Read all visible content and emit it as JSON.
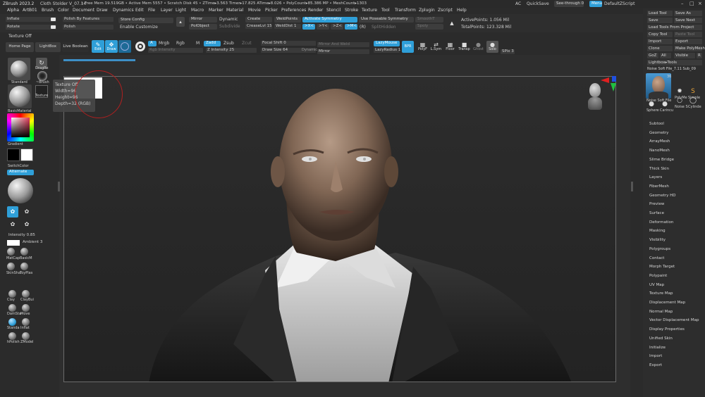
{
  "app": {
    "title": "ZBrush 2023.2",
    "project": "Cloth Stolder V_07.14",
    "stats": "• Free Mem 19.519GB • Active Mem 5557 • Scratch Disk 45 • ZTime▸3.563 Timer▸17.825 ATime▸8.026 • PolyCount▸85.386 MP • MeshCount▸1303",
    "ac": "AC",
    "quicksave": "QuickSave",
    "see_through": "See-through  0",
    "menus_btn": "Menus",
    "default_zscript": "DefaultZScript"
  },
  "menubar": [
    "Alpha",
    "ArtB01",
    "Brush",
    "Color",
    "Document",
    "Draw",
    "Dynamics",
    "Edit",
    "File",
    "Layer",
    "Light",
    "Macro",
    "Marker",
    "Material",
    "Movie",
    "Picker",
    "Preferences",
    "Render",
    "Stencil",
    "Stroke",
    "Texture",
    "Tool",
    "Transform",
    "Zplugin",
    "Zscript",
    "Help"
  ],
  "toolbar1": {
    "inflate": "Inflate",
    "rotate": "Rotate",
    "polish_by_features": "Polish By Features",
    "polish": "Polish",
    "store_config": "Store Config",
    "enable_customize": "Enable Customize",
    "mirror": "Mirror",
    "polyobject": "PolObject",
    "dynamic": "Dynamic",
    "subdivide": "Subdivide",
    "create": "Create",
    "creaselvl": "CreaseLvl  15",
    "weld_points": "WeldPoints",
    "weld_dist": "WeldDist  1",
    "activate_symmetry": "Activate Symmetry",
    "x": ">X<",
    "y": ">Y<",
    "z": ">Z<",
    "m": ">M<",
    "r": "(R)",
    "use_poseable_symmetry": "Use Poseable Symmetry",
    "split_unmasked": "SplitHidden",
    "smt": "SmoothT",
    "spoly": "Spoly",
    "active_points": "ActivePoints: 1.056 Mil",
    "total_points": "TotalPoints: 123.328 Mil"
  },
  "toolbar2": {
    "texture_off": "Texture Off",
    "home_page": "Home Page",
    "lightbox": "LightBox",
    "live_boolean": "Live Boolean",
    "edit": "Edit",
    "move": "Move",
    "draw": "Draw",
    "a": "A",
    "mrgb": "Mrgb",
    "rgb": "Rgb",
    "m": "M",
    "zadd": "Zadd",
    "zsub": "Zsub",
    "zcut": "Zcut",
    "rgb_intensity": "Rgb Intensity",
    "z_intensity": "Z Intensity  25",
    "focal_shift": "Focal Shift  0",
    "draw_size": "Draw Size  64",
    "dynamic": "Dynamic",
    "mirror_and_weld": "Mirror And Weld",
    "mirror": "Mirror",
    "lazymouse": "LazyMouse",
    "lazyradius": "LazyRadius  1",
    "persp": "Persp",
    "floor": "Floor",
    "l_sym": "L.Sym",
    "xyz": "xyz",
    "transp": "Transp",
    "ghost": "Ghost",
    "solo": "Solo",
    "spix": "SPix  3",
    "bpr": "BPR",
    "polyf": "PolyF",
    "local": "Local",
    "dynamic2": "Dynamic"
  },
  "left_panel": {
    "brush_name": "Standard",
    "dragrect": "DragRe",
    "brush_alpha": "~Brush",
    "texture": "Texture",
    "material": "BasicMaterial",
    "gradient": "Gradient",
    "switch_color": "SwitchColor",
    "alternate": "Alternate",
    "intensity": "Intensity  0.85",
    "ambient": "Ambient  3",
    "materials": [
      "MatCap",
      "BasicM",
      "SkinSha",
      "ToyPlas"
    ],
    "brushes": [
      "Clay",
      "ClayBui",
      "DamSta",
      "Move",
      "Standa",
      "Inflat",
      "hPolish",
      "ZModel"
    ]
  },
  "canvas": {
    "tooltip": [
      "Texture Off",
      "Width=96",
      "Height=96",
      "Depth=32 (RGB)"
    ]
  },
  "right_panel": {
    "top_buttons": [
      [
        "Load Tool",
        "Save As"
      ],
      [
        "Save",
        "Save Next"
      ],
      [
        "Load Tools From Project"
      ],
      [
        "Copy Tool",
        "Paste Tool"
      ],
      [
        "Import",
        "Export"
      ],
      [
        "Clone",
        "Make PolyMesh3D"
      ],
      [
        "GoZ",
        "All",
        "Visible",
        "R"
      ],
      [
        "Lightbox▸Tools"
      ]
    ],
    "tool_name": "Noise Soft File_7.11 Sub_09",
    "tool_count": "36",
    "thumbs": [
      "Noise Soft File",
      "PolyMe",
      "Simple",
      "Noise S",
      "Cylinde",
      "Sphere",
      "Carincu"
    ],
    "sections": [
      "Subtool",
      "Geometry",
      "ArrayMesh",
      "NanoMesh",
      "Slime Bridge",
      "Thick Skin",
      "Layers",
      "FiberMesh",
      "Geometry HD",
      "Preview",
      "Surface",
      "Deformation",
      "Masking",
      "Visibility",
      "Polygroups",
      "Contact",
      "Morph Target",
      "Polypaint",
      "UV Map",
      "Texture Map",
      "Displacement Map",
      "Normal Map",
      "Vector Displacement Map",
      "Display Properties",
      "Unified Skin",
      "Initialize",
      "Import",
      "Export"
    ]
  },
  "colors": {
    "accent": "#2f9fd8",
    "bg": "#2b2b2b",
    "panel": "#333333"
  }
}
